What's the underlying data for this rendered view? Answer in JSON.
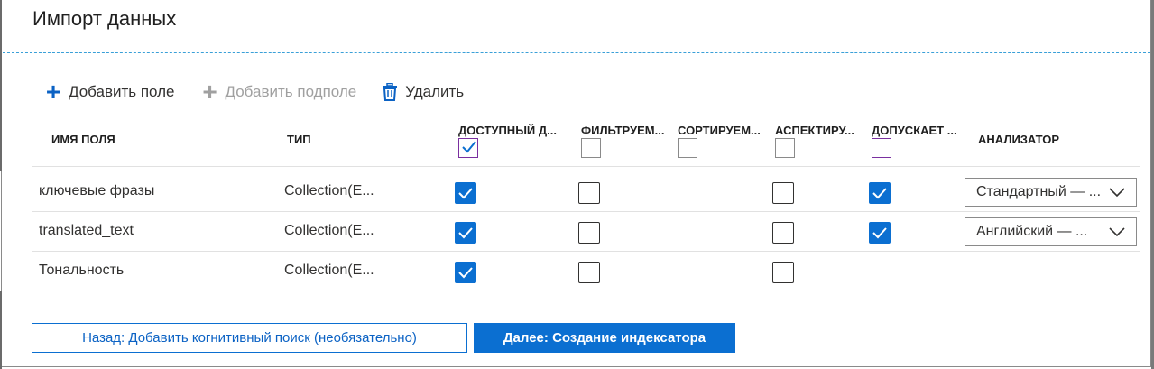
{
  "page": {
    "title": "Импорт данных"
  },
  "toolbar": {
    "add_field": "Добавить поле",
    "add_subfield": "Добавить подполе",
    "delete": "Удалить"
  },
  "columns": {
    "name": "ИМЯ ПОЛЯ",
    "type": "ТИП",
    "retrievable": "ДОСТУПНЫЙ Д...",
    "filterable": "ФИЛЬТРУЕМ...",
    "sortable": "СОРТИРУЕМ...",
    "facetable": "АСПЕКТИРУ...",
    "searchable": "ДОПУСКАЕТ ...",
    "analyzer": "АНАЛИЗАТОР"
  },
  "header_checks": {
    "retrievable": true,
    "filterable": false,
    "sortable": false,
    "facetable": false,
    "searchable": false
  },
  "rows": [
    {
      "name": "ключевые фразы",
      "type": "Collection(E...",
      "retrievable": true,
      "filterable": false,
      "facetable": false,
      "searchable": true,
      "analyzer": "Стандартный — ..."
    },
    {
      "name": "translated_text",
      "type": "Collection(E...",
      "retrievable": true,
      "filterable": false,
      "facetable": false,
      "searchable": true,
      "analyzer": "Английский — ..."
    },
    {
      "name": "Тональность",
      "type": "Collection(E...",
      "retrievable": true,
      "filterable": false,
      "facetable": false
    }
  ],
  "buttons": {
    "back": "Назад: Добавить когнитивный поиск (необязательно)",
    "next": "Далее: Создание индексатора"
  },
  "colors": {
    "accent": "#0b6fd1",
    "link": "#0b62c4",
    "disabled": "#a0a0a0",
    "divider": "#3aa0d8",
    "header_checkbox_border": "#7a2fa0"
  },
  "icons": [
    "plus-icon",
    "trash-icon",
    "checkmark-icon",
    "chevron-down-icon"
  ]
}
